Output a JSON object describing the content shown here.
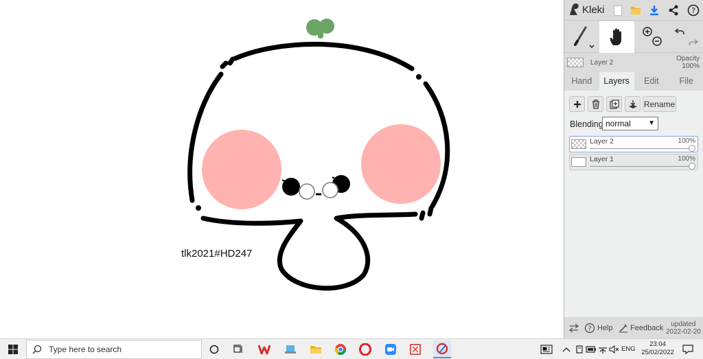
{
  "canvas": {
    "watermark_text": "tlk2021#HD247"
  },
  "header": {
    "app_name": "Kleki",
    "icons": [
      "new-image-icon",
      "open-folder-icon",
      "download-icon",
      "share-icon",
      "help-icon"
    ]
  },
  "tools": {
    "brush": "brush-icon",
    "hand": "hand-icon",
    "zoom_in": "zoom-in-icon",
    "zoom_out": "zoom-out-icon",
    "undo": "undo-icon",
    "redo": "redo-icon"
  },
  "layer_info": {
    "name": "Layer 2",
    "opacity_label": "Opacity",
    "opacity_value": "100%"
  },
  "tabs": [
    {
      "label": "Hand",
      "active": false
    },
    {
      "label": "Layers",
      "active": true
    },
    {
      "label": "Edit",
      "active": false
    },
    {
      "label": "File",
      "active": false
    }
  ],
  "layers_panel": {
    "rename_label": "Rename",
    "blending_label": "Blending",
    "blending_value": "normal",
    "layers": [
      {
        "name": "Layer 2",
        "opacity": "100%",
        "selected": true
      },
      {
        "name": "Layer 1",
        "opacity": "100%",
        "selected": false
      }
    ]
  },
  "footer": {
    "help_label": "Help",
    "feedback_label": "Feedback",
    "updated_label": "updated",
    "updated_date": "2022-02-20"
  },
  "taskbar": {
    "search_placeholder": "Type here to search",
    "lang": "ENG",
    "time": "23:04",
    "date": "25/02/2022"
  },
  "colors": {
    "panel_bg": "#dcdcdc",
    "tab_body_bg": "#eef0f0",
    "accent_blue": "#1a73e8",
    "cheek_pink": "#ffb3b0",
    "leaf_green": "#6aa565"
  }
}
